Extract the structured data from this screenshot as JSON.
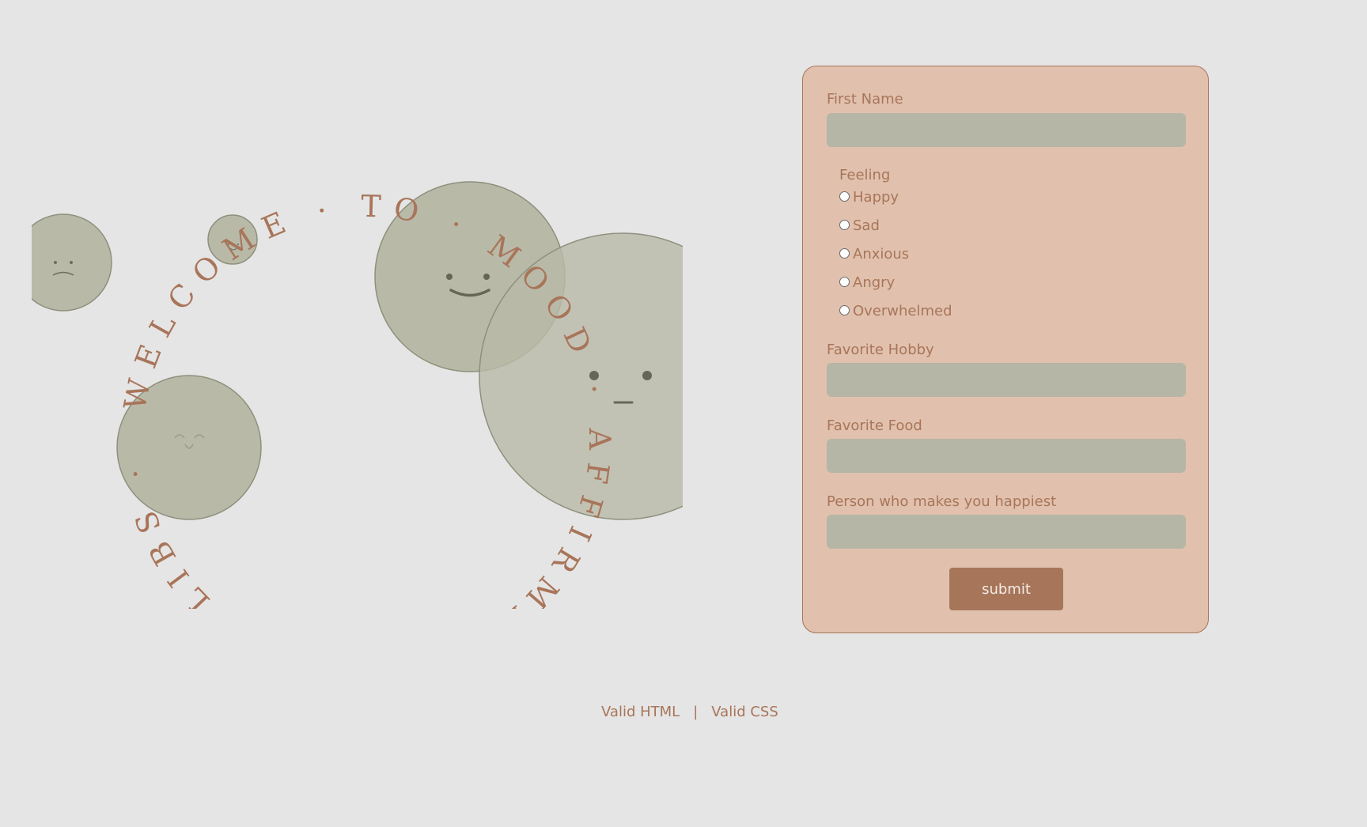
{
  "hero": {
    "circular_text": "WELCOME · TO · MOOD · AFFIRMATION · MADLIBS ·"
  },
  "form": {
    "first_name": {
      "label": "First Name",
      "value": ""
    },
    "feeling": {
      "legend": "Feeling",
      "options": [
        "Happy",
        "Sad",
        "Anxious",
        "Angry",
        "Overwhelmed"
      ]
    },
    "favorite_hobby": {
      "label": "Favorite Hobby",
      "value": ""
    },
    "favorite_food": {
      "label": "Favorite Food",
      "value": ""
    },
    "happiest_person": {
      "label": "Person who makes you happiest",
      "value": ""
    },
    "submit_label": "submit"
  },
  "footer": {
    "valid_html": "Valid HTML",
    "separator": "|",
    "valid_css": "Valid CSS"
  },
  "colors": {
    "background": "#e5e5e5",
    "accent": "#a8755a",
    "card": "#e1c1ad",
    "input": "#b5b6a6",
    "face": "#b9b9a8"
  }
}
